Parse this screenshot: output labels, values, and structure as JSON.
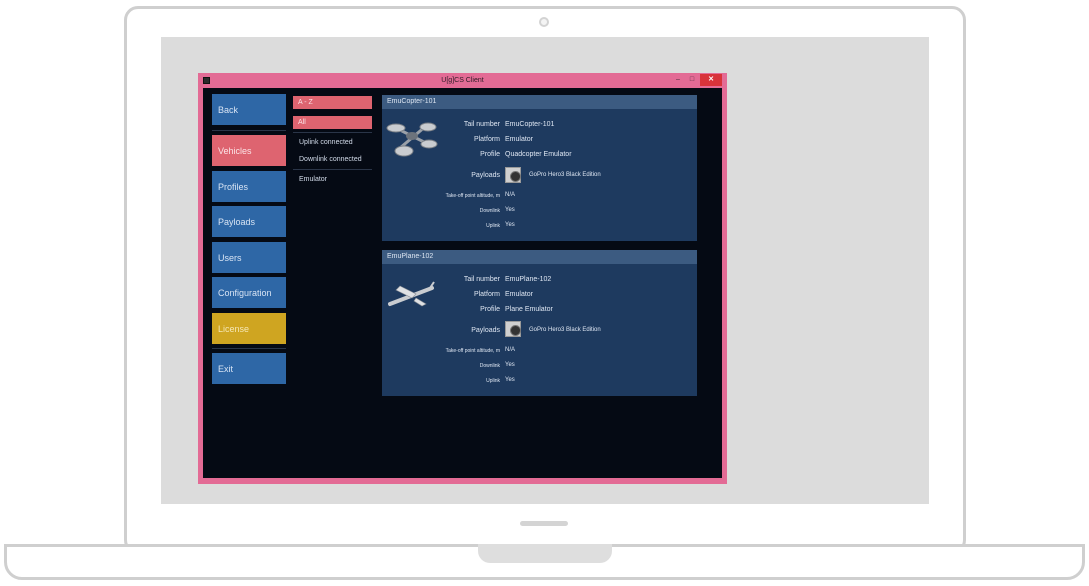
{
  "window": {
    "title": "U[g]CS Client",
    "minimize_glyph": "–",
    "maximize_glyph": "□",
    "close_glyph": "✕"
  },
  "nav": {
    "items": [
      {
        "label": "Back"
      },
      {
        "label": "Vehicles"
      },
      {
        "label": "Profiles"
      },
      {
        "label": "Payloads"
      },
      {
        "label": "Users"
      },
      {
        "label": "Configuration"
      },
      {
        "label": "License"
      },
      {
        "label": "Exit"
      }
    ]
  },
  "filters": {
    "sort_label": "A - Z",
    "all_label": "All",
    "items": [
      "Uplink connected",
      "Downlink connected",
      "Emulator"
    ]
  },
  "labels": {
    "tail_number": "Tail number",
    "platform": "Platform",
    "profile": "Profile",
    "payloads": "Payloads",
    "takeoff_altitude": "Take-off point altitude, m",
    "downlink": "Downlink",
    "uplink": "Uplink"
  },
  "vehicles": [
    {
      "name": "EmuCopter-101",
      "tail_number": "EmuCopter-101",
      "platform": "Emulator",
      "profile": "Quadcopter Emulator",
      "payload": "GoPro Hero3 Black Edition",
      "takeoff_altitude": "N/A",
      "downlink": "Yes",
      "uplink": "Yes"
    },
    {
      "name": "EmuPlane-102",
      "tail_number": "EmuPlane-102",
      "platform": "Emulator",
      "profile": "Plane Emulator",
      "payload": "GoPro Hero3 Black Edition",
      "takeoff_altitude": "N/A",
      "downlink": "Yes",
      "uplink": "Yes"
    }
  ],
  "colors": {
    "window_frame": "#e36b95",
    "nav_default": "#2e67a6",
    "nav_active": "#de6470",
    "nav_license": "#cfa521",
    "card_bg": "#1e3a5f",
    "card_header": "#3c5b81",
    "app_bg": "#050a14"
  }
}
